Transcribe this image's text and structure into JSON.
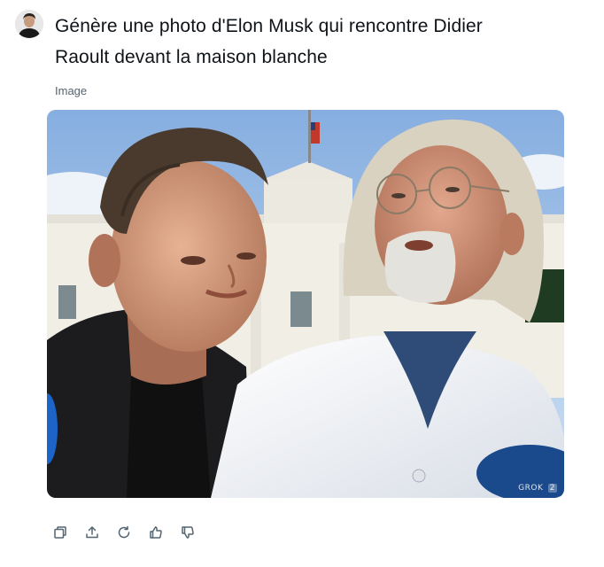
{
  "prompt": {
    "line1": "Génère une photo d'Elon Musk qui rencontre Didier",
    "line2": "Raoult devant la maison blanche"
  },
  "attachment": {
    "label": "Image",
    "watermark": "GROK",
    "watermark_badge": "2"
  },
  "actions": {
    "copy": "copy-icon",
    "share": "share-icon",
    "regenerate": "regenerate-icon",
    "like": "thumbs-up-icon",
    "dislike": "thumbs-down-icon"
  },
  "colors": {
    "text": "#0f1419",
    "muted": "#536471",
    "icon": "#536471"
  }
}
